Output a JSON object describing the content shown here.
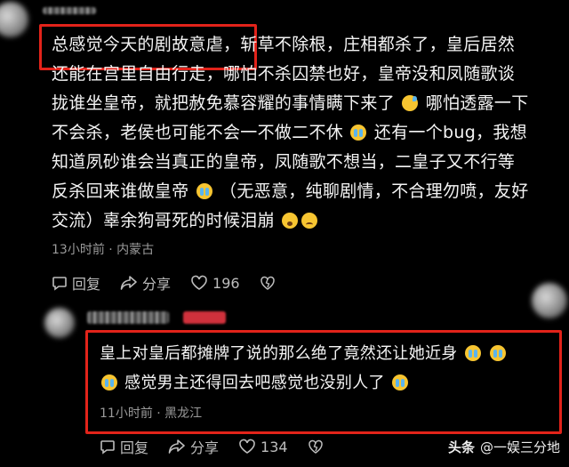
{
  "comment1": {
    "text_plain_before": "总感觉今天的剧故意虐，斩草不除根，庄相都杀了，皇后居然\n还能在宫里自由行走，哪怕不杀囚禁也好，皇帝没和凤随歌谈\n拢谁坐皇帝，就把赦免慕容耀的事情瞒下来了",
    "text_plain_2": "哪怕透露一下\n不会杀，老侯也可能不会一不做二不休",
    "text_plain_3": "还有一个bug，我想\n知道夙砂谁会当真正的皇帝，凤随歌不想当，二皇子又不行等\n反杀回来谁做皇帝",
    "text_plain_4": "（无恶意，纯聊剧情，不合理勿喷，友好\n交流）辜余狗哥死的时候泪崩",
    "meta": "13小时前 · 内蒙古",
    "reply_label": "回复",
    "share_label": "分享",
    "like_count": "196"
  },
  "comment2": {
    "text_line1": "皇上对皇后都摊牌了说的那么绝了竟然还让她近身",
    "text_line2": "感觉男主还得回去吧感觉也没别人了",
    "meta": "11小时前 · 黑龙江",
    "reply_label": "回复",
    "share_label": "分享",
    "like_count": "134"
  },
  "watermark": {
    "brand": "头条",
    "account": "@一娱三分地"
  },
  "colors": {
    "highlight_box": "#e2231a",
    "background": "#000000"
  }
}
